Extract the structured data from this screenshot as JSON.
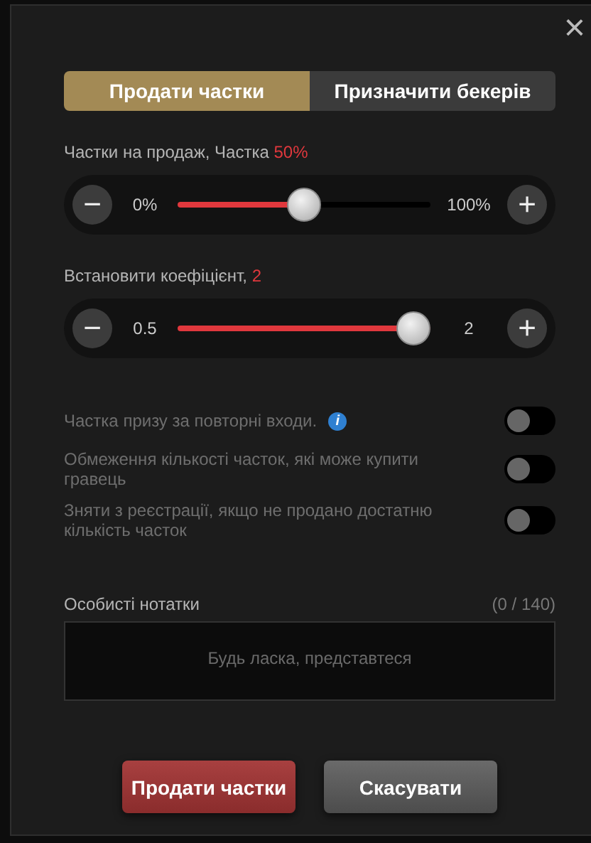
{
  "close": "×",
  "tabs": [
    {
      "label": "Продати частки",
      "selected": true
    },
    {
      "label": "Призначити бекерів",
      "selected": false
    }
  ],
  "sliders": [
    {
      "label": "Частки на продаж, Частка ",
      "value": "50%",
      "min": "0%",
      "max": "100%",
      "level": 0.5,
      "minus": "−",
      "plus": "+"
    },
    {
      "label": "Встановити коефіцієнт, ",
      "value": "2",
      "min": "0.5",
      "max": "2",
      "level": 1,
      "minus": "−",
      "plus": "+"
    }
  ],
  "options": [
    {
      "label": "Частка призу за повторні входи.",
      "info": "i",
      "on": false
    },
    {
      "label": "Обмеження кількості часток, які може купити гравець",
      "on": false
    },
    {
      "label": "Зняти з реєстрації, якщо не продано достатню кількість часток",
      "on": false
    }
  ],
  "notes": {
    "label": "Особисті нотатки",
    "counter": "(0 / 140)",
    "placeholder": "Будь ласка, представтеся"
  },
  "buttons": [
    {
      "label": "Продати частки",
      "kind": "primary"
    },
    {
      "label": "Скасувати",
      "kind": "secondary"
    }
  ]
}
